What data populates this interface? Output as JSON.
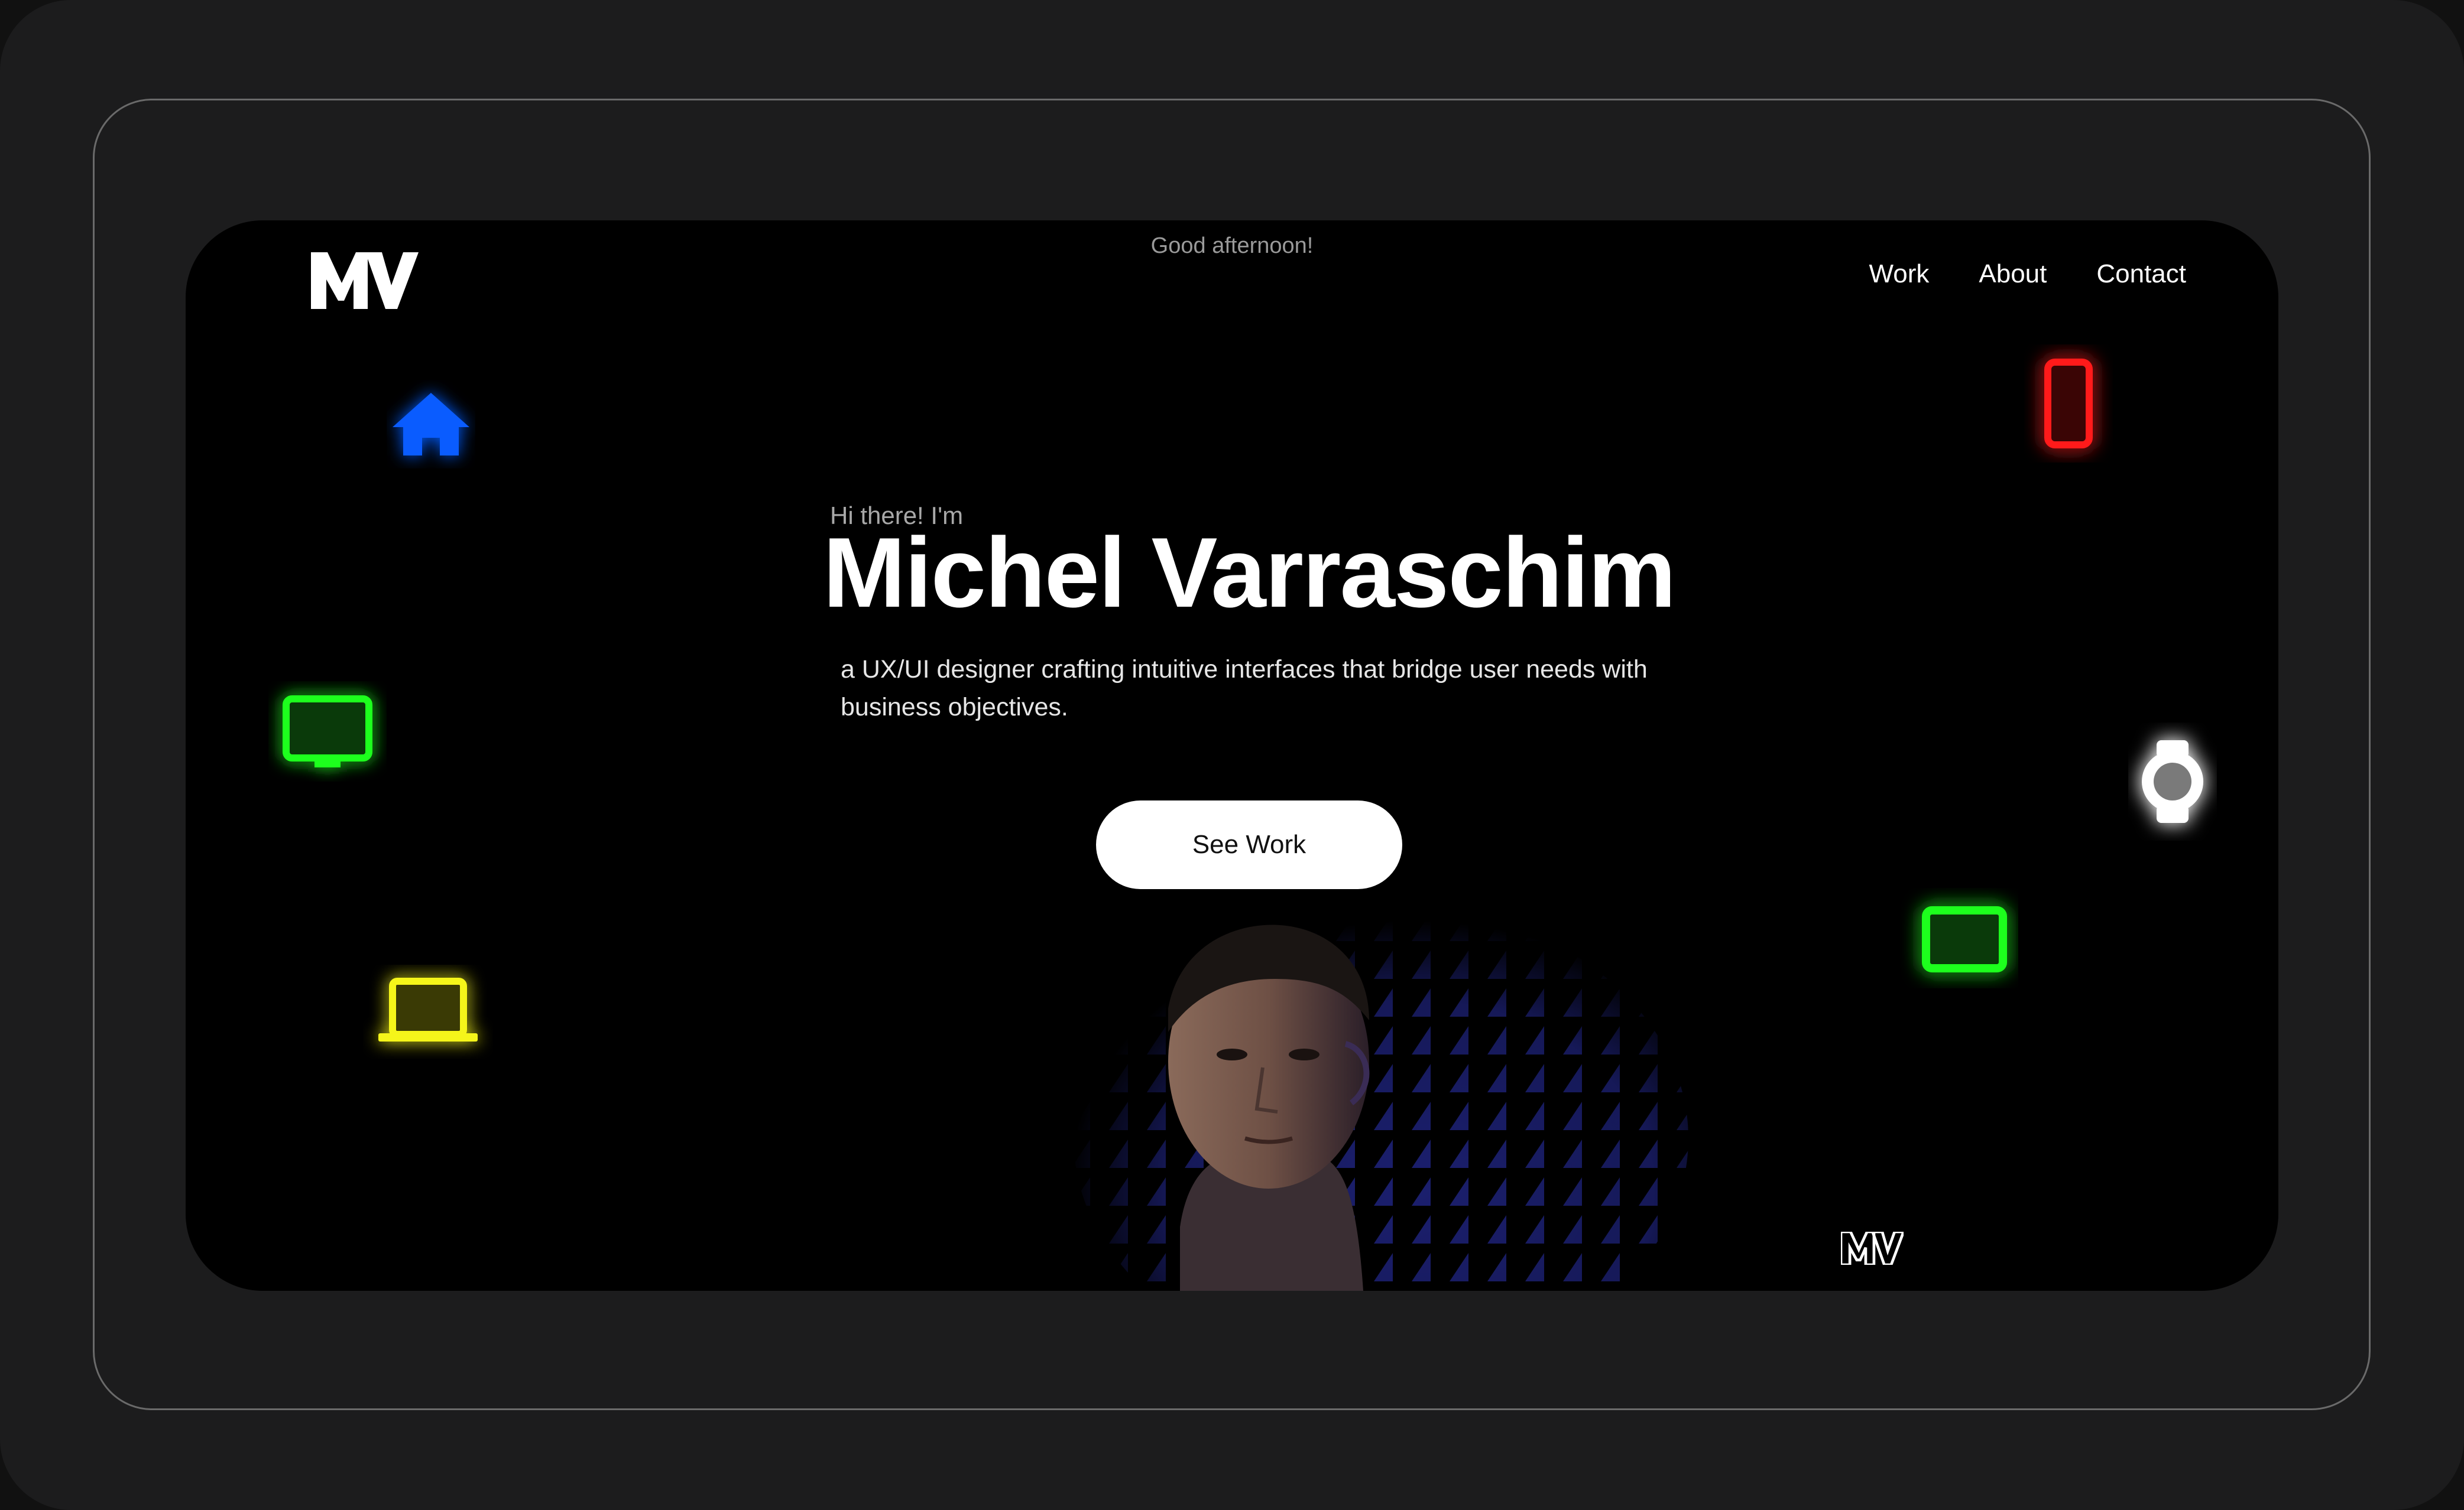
{
  "header": {
    "logo_label": "MV",
    "greeting": "Good afternoon!"
  },
  "nav": {
    "items": [
      {
        "label": "Work"
      },
      {
        "label": "About"
      },
      {
        "label": "Contact"
      }
    ]
  },
  "hero": {
    "intro": "Hi there! I'm",
    "name": "Michel Varraschim",
    "tagline": "a UX/UI designer crafting intuitive interfaces that bridge user needs with business objectives.",
    "cta_label": "See Work"
  },
  "decor": {
    "icons": [
      "home-icon",
      "monitor-icon",
      "laptop-icon",
      "phone-icon",
      "watch-icon",
      "tablet-icon"
    ],
    "colors": {
      "home": "#0a5cff",
      "monitor": "#1dff1d",
      "laptop": "#f5f51a",
      "phone": "#ff1a1a",
      "watch": "#ffffff",
      "tablet": "#1dff1d",
      "background": "#000000",
      "device_frame": "#1c1c1d"
    }
  },
  "footer": {
    "logo_label": "MV"
  }
}
